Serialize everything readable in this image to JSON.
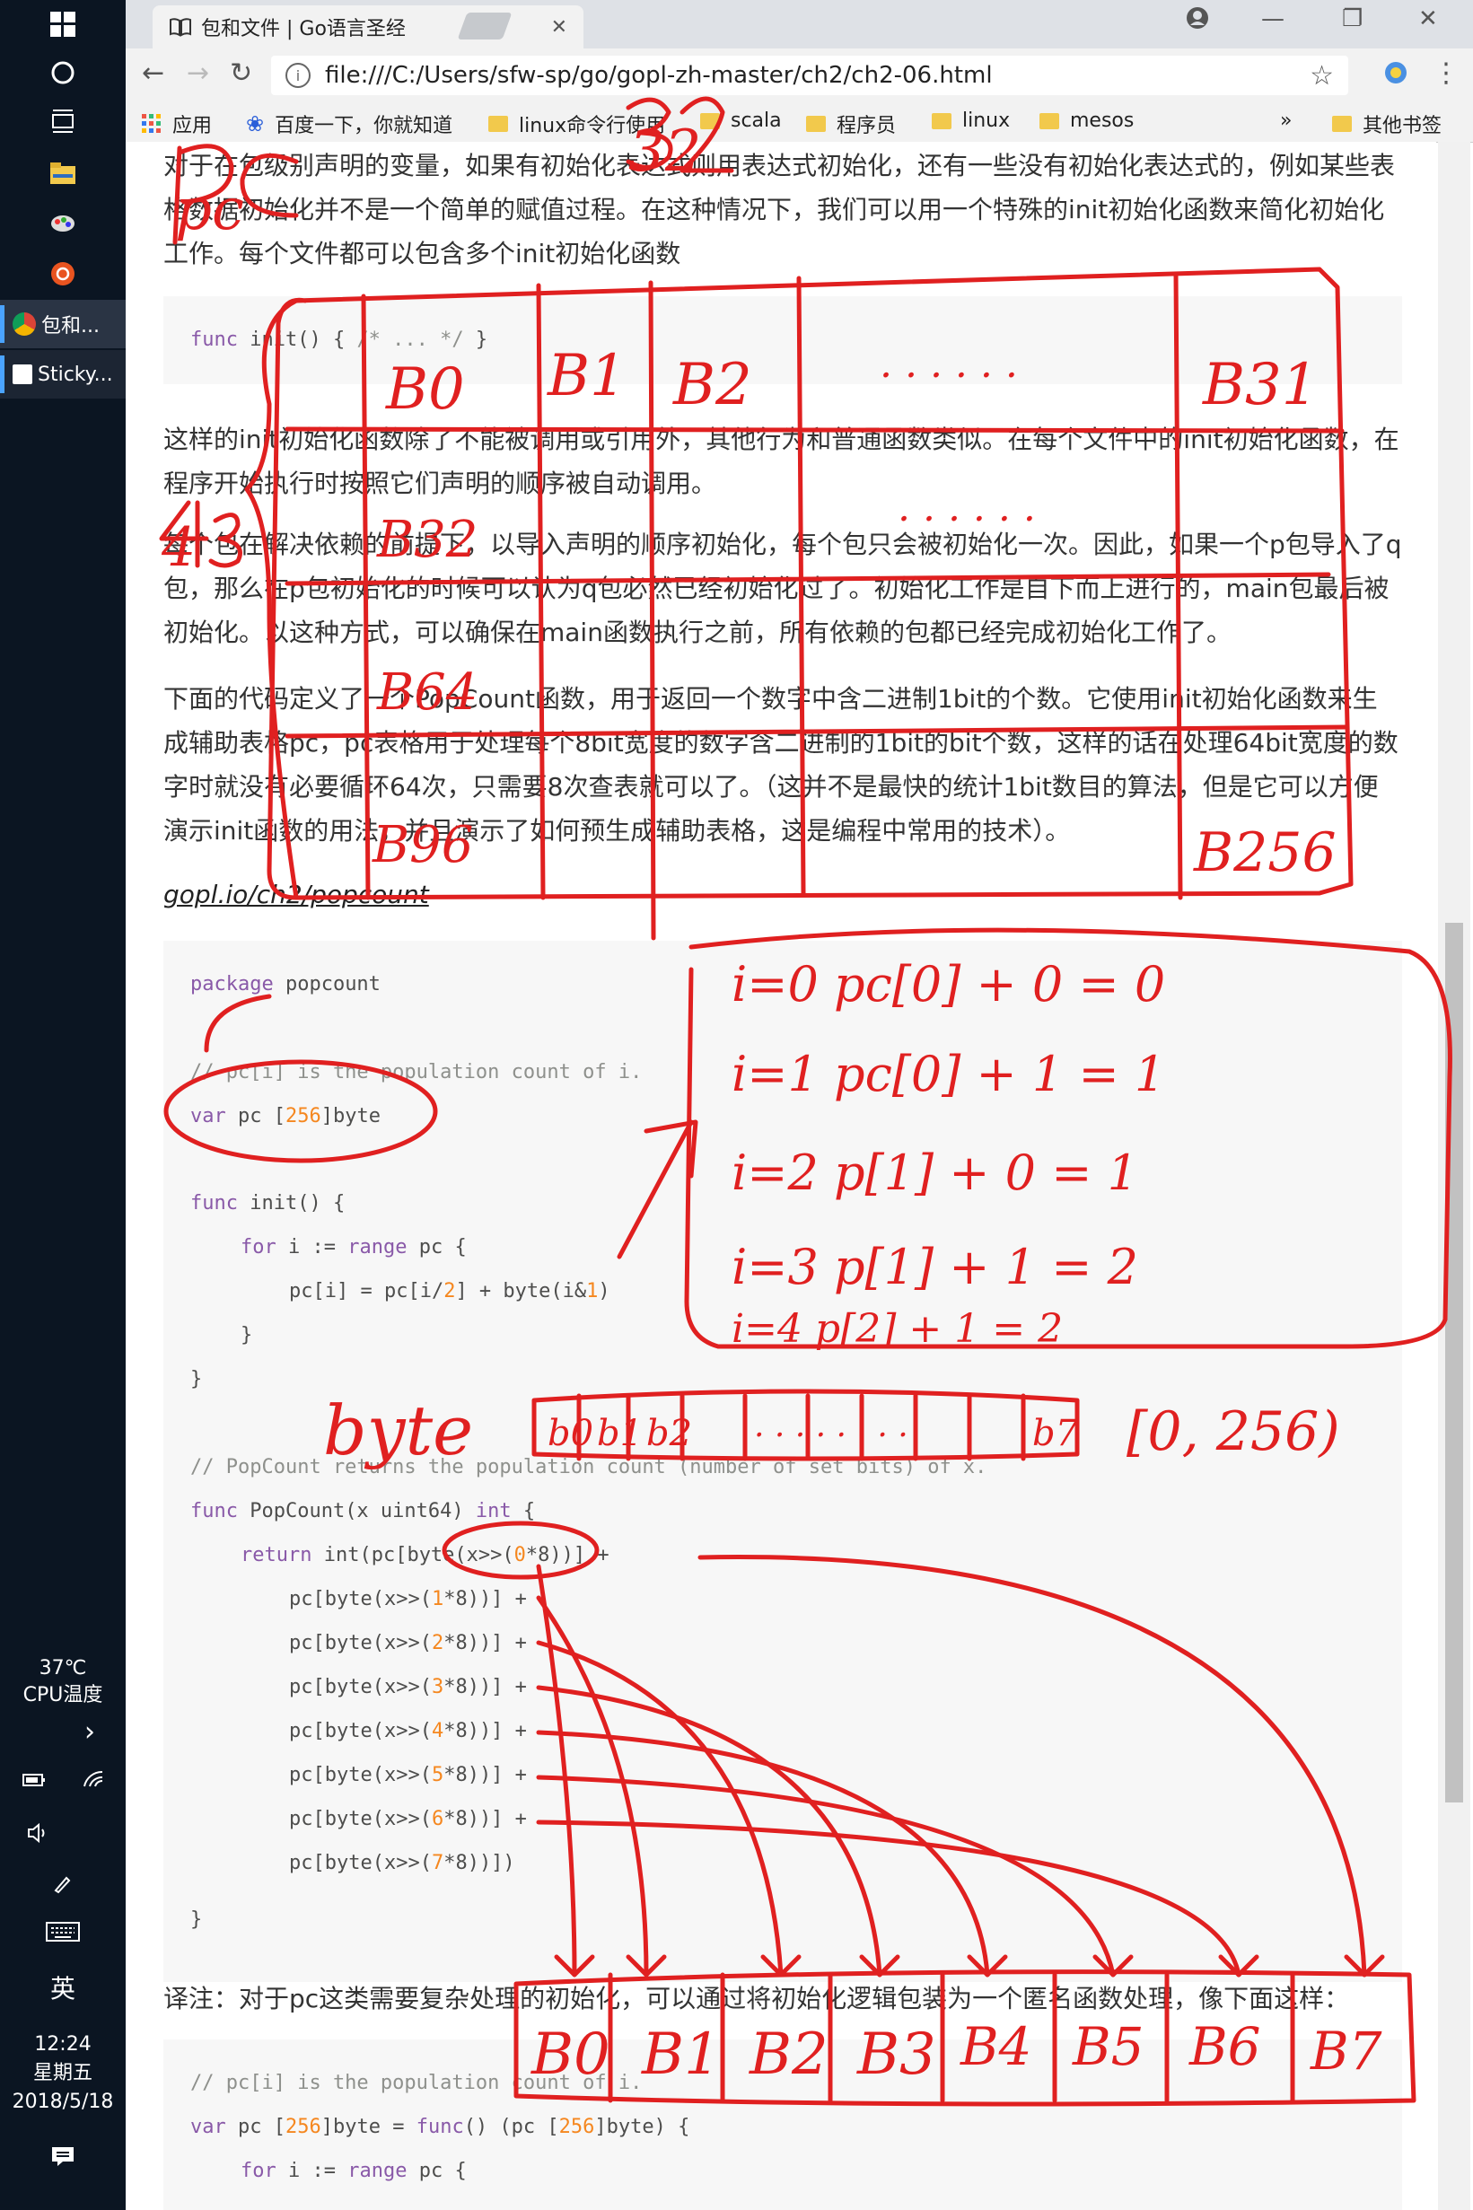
{
  "taskbar": {
    "apps": [
      {
        "label": "包和...",
        "icon": "chrome-icon"
      },
      {
        "label": "Sticky...",
        "icon": "sticky-notes-icon"
      }
    ],
    "temperature": "37℃",
    "cpu_label": "CPU温度",
    "ime": "英",
    "time": "12:24",
    "weekday": "星期五",
    "date": "2018/5/18"
  },
  "browser": {
    "tab_title": "包和文件 | Go语言圣经",
    "url": "file:///C:/Users/sfw-sp/go/gopl-zh-master/ch2/ch2-06.html",
    "bookmarks": [
      "应用",
      "百度一下，你就知道",
      "linux命令行使用",
      "scala",
      "程序员",
      "linux",
      "mesos"
    ],
    "bookmarks_more": "»",
    "other_bookmarks": "其他书签"
  },
  "page": {
    "p1": "对于在包级别声明的变量，如果有初始化表达式则用表达式初始化，还有一些没有初始化表达式的，例如某些表格数据初始化并不是一个简单的赋值过程。在这种情况下，我们可以用一个特殊的init初始化函数来简化初始化工作。每个文件都可以包含多个init初始化函数",
    "code1": "func init() { /* ... */ }",
    "p2": "这样的init初始化函数除了不能被调用或引用外，其他行为和普通函数类似。在每个文件中的init初始化函数，在程序开始执行时按照它们声明的顺序被自动调用。",
    "p3": "每个包在解决依赖的前提下，以导入声明的顺序初始化，每个包只会被初始化一次。因此，如果一个p包导入了q包，那么在p包初始化的时候可以认为q包必然已经初始化过了。初始化工作是自下而上进行的，main包最后被初始化。以这种方式，可以确保在main函数执行之前，所有依赖的包都已经完成初始化工作了。",
    "p4": "下面的代码定义了一个PopCount函数，用于返回一个数字中含二进制1bit的个数。它使用init初始化函数来生成辅助表格pc，pc表格用于处理每个8bit宽度的数字含二进制的1bit的bit个数，这样的话在处理64bit宽度的数字时就没有必要循环64次，只需要8次查表就可以了。（这并不是最快的统计1bit数目的算法，但是它可以方便演示init函数的用法，并且演示了如何预生成辅助表格，这是编程中常用的技术）。",
    "link": "gopl.io/ch2/popcount",
    "code2": {
      "package_kw": "package",
      "package_name": " popcount",
      "comment1": "// pc[i] is the population count of i.",
      "var_kw": "var",
      "var_rest_a": " pc [",
      "var_num": "256",
      "var_rest_b": "]byte",
      "func_init": "func init() {",
      "for_kw": "for",
      "for_mid": " i := ",
      "range_kw": "range",
      "for_end": " pc {",
      "assign_a": "pc[i] = pc[i/",
      "assign_n2": "2",
      "assign_b": "] + byte(i&",
      "assign_n1": "1",
      "assign_c": ")",
      "close_inner": "}",
      "close_outer": "}",
      "comment2": "// PopCount returns the population count (number of set bits) of x.",
      "func_popcount": "func PopCount(x uint64) int {",
      "return_kw": "return",
      "return_a": " int(pc[byte(x>>(",
      "return_n": "0",
      "return_b": "*8))] +",
      "shifts": [
        {
          "pre": "pc[byte(x>>(",
          "n": "1",
          "post": "*8))] +"
        },
        {
          "pre": "pc[byte(x>>(",
          "n": "2",
          "post": "*8))] +"
        },
        {
          "pre": "pc[byte(x>>(",
          "n": "3",
          "post": "*8))] +"
        },
        {
          "pre": "pc[byte(x>>(",
          "n": "4",
          "post": "*8))] +"
        },
        {
          "pre": "pc[byte(x>>(",
          "n": "5",
          "post": "*8))] +"
        },
        {
          "pre": "pc[byte(x>>(",
          "n": "6",
          "post": "*8))] +"
        },
        {
          "pre": "pc[byte(x>>(",
          "n": "7",
          "post": "*8))])"
        }
      ],
      "close_func": "}"
    },
    "p5": "译注：对于pc这类需要复杂处理的初始化，可以通过将初始化逻辑包装为一个匿名函数处理，像下面这样：",
    "code3": {
      "comment": "// pc[i] is the population count of i.",
      "var_a": "var pc [",
      "var_num": "256",
      "var_b": "]byte = ",
      "func_kw": "func",
      "var_c": "() (pc [",
      "var_num2": "256",
      "var_d": "]byte) {",
      "for_kw": "for",
      "for_mid": " i := ",
      "range_kw": "range",
      "for_end": " pc {"
    }
  },
  "annotations": {
    "color": "#e02020",
    "pc_label": "pc",
    "n32_label": "32",
    "n4_label": "4",
    "grid_labels": [
      "B0",
      "B1",
      "B2",
      ". . . . . .",
      "B31",
      ". . . . . .",
      "B32",
      "B64",
      "B96",
      "B256"
    ],
    "table_rows": [
      "i=0   pc[0] + 0   = 0",
      "i=1   pc[0] + 1   = 1",
      "i=2   p[1] + 0   = 1",
      "i=3   p[1] + 1   = 2",
      "i=4   p[2] + 1   = 2"
    ],
    "byte_label": "byte",
    "byte_cells": [
      "b0",
      "b1",
      "b2",
      ". . . . . . . .",
      "b7"
    ],
    "range_label": "[0, 256)",
    "bottom_cells": [
      "B0",
      "B1",
      "B2",
      "B3",
      "B4",
      "B5",
      "B6",
      "B7"
    ]
  }
}
